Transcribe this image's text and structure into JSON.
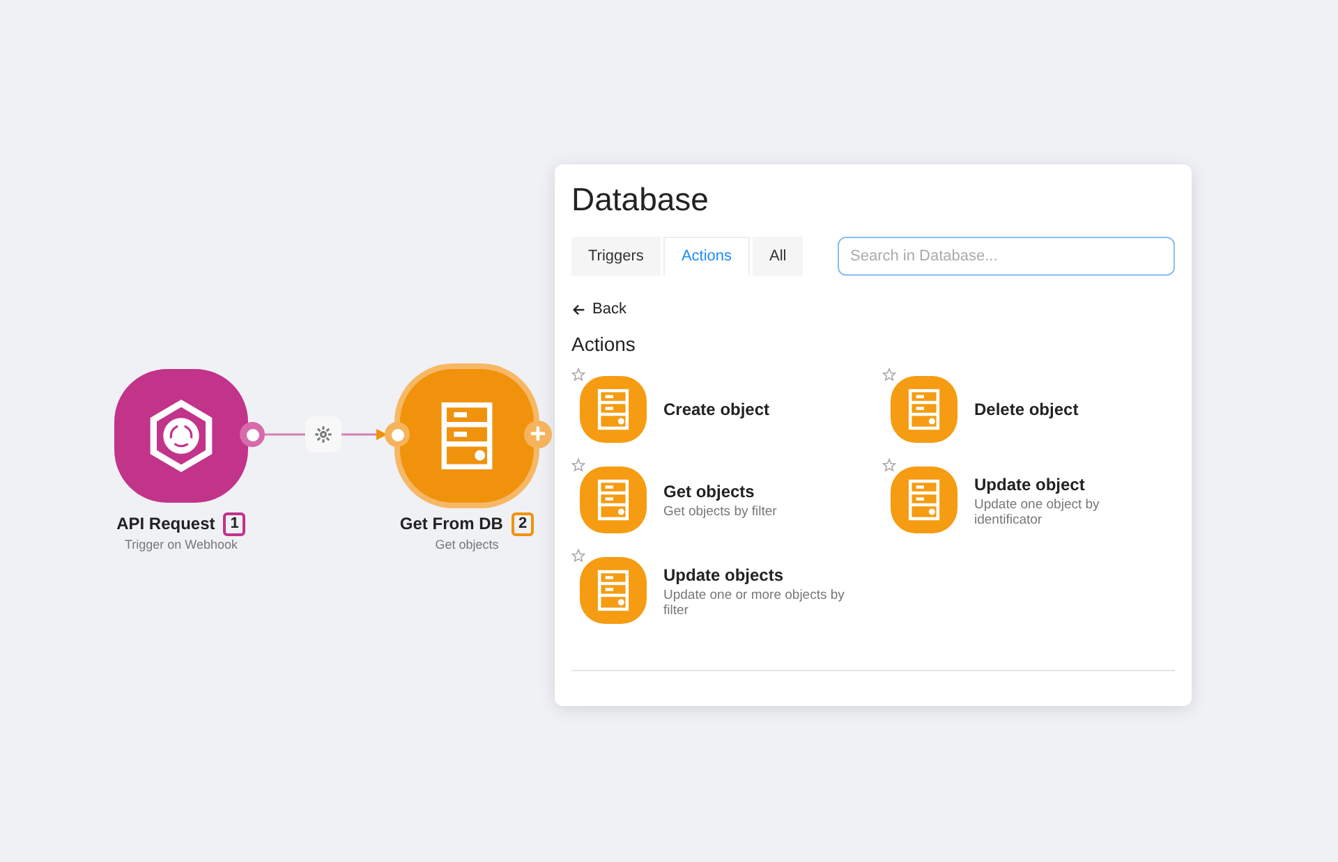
{
  "nodes": [
    {
      "kind": "webhook",
      "title": "API Request",
      "number": "1",
      "subtitle": "Trigger on Webhook",
      "color": "#c2338a",
      "selected": false
    },
    {
      "kind": "database",
      "title": "Get From DB",
      "number": "2",
      "subtitle": "Get objects",
      "color": "#f0920c",
      "selected": true,
      "add": "+"
    }
  ],
  "panel": {
    "title": "Database",
    "tabs": [
      {
        "label": "Triggers",
        "selected": false
      },
      {
        "label": "Actions",
        "selected": true
      },
      {
        "label": "All",
        "selected": false
      }
    ],
    "search": {
      "placeholder": "Search in Database..."
    },
    "back": "Back",
    "section": "Actions",
    "items": [
      {
        "title": "Create object",
        "starred": false
      },
      {
        "title": "Delete object",
        "starred": false
      },
      {
        "title": "Get objects",
        "description": "Get objects by filter",
        "starred": false
      },
      {
        "title": "Update object",
        "description": "Update one object by identificator",
        "starred": false
      },
      {
        "title": "Update objects",
        "description": "Update one or more objects by filter",
        "starred": false
      }
    ]
  }
}
